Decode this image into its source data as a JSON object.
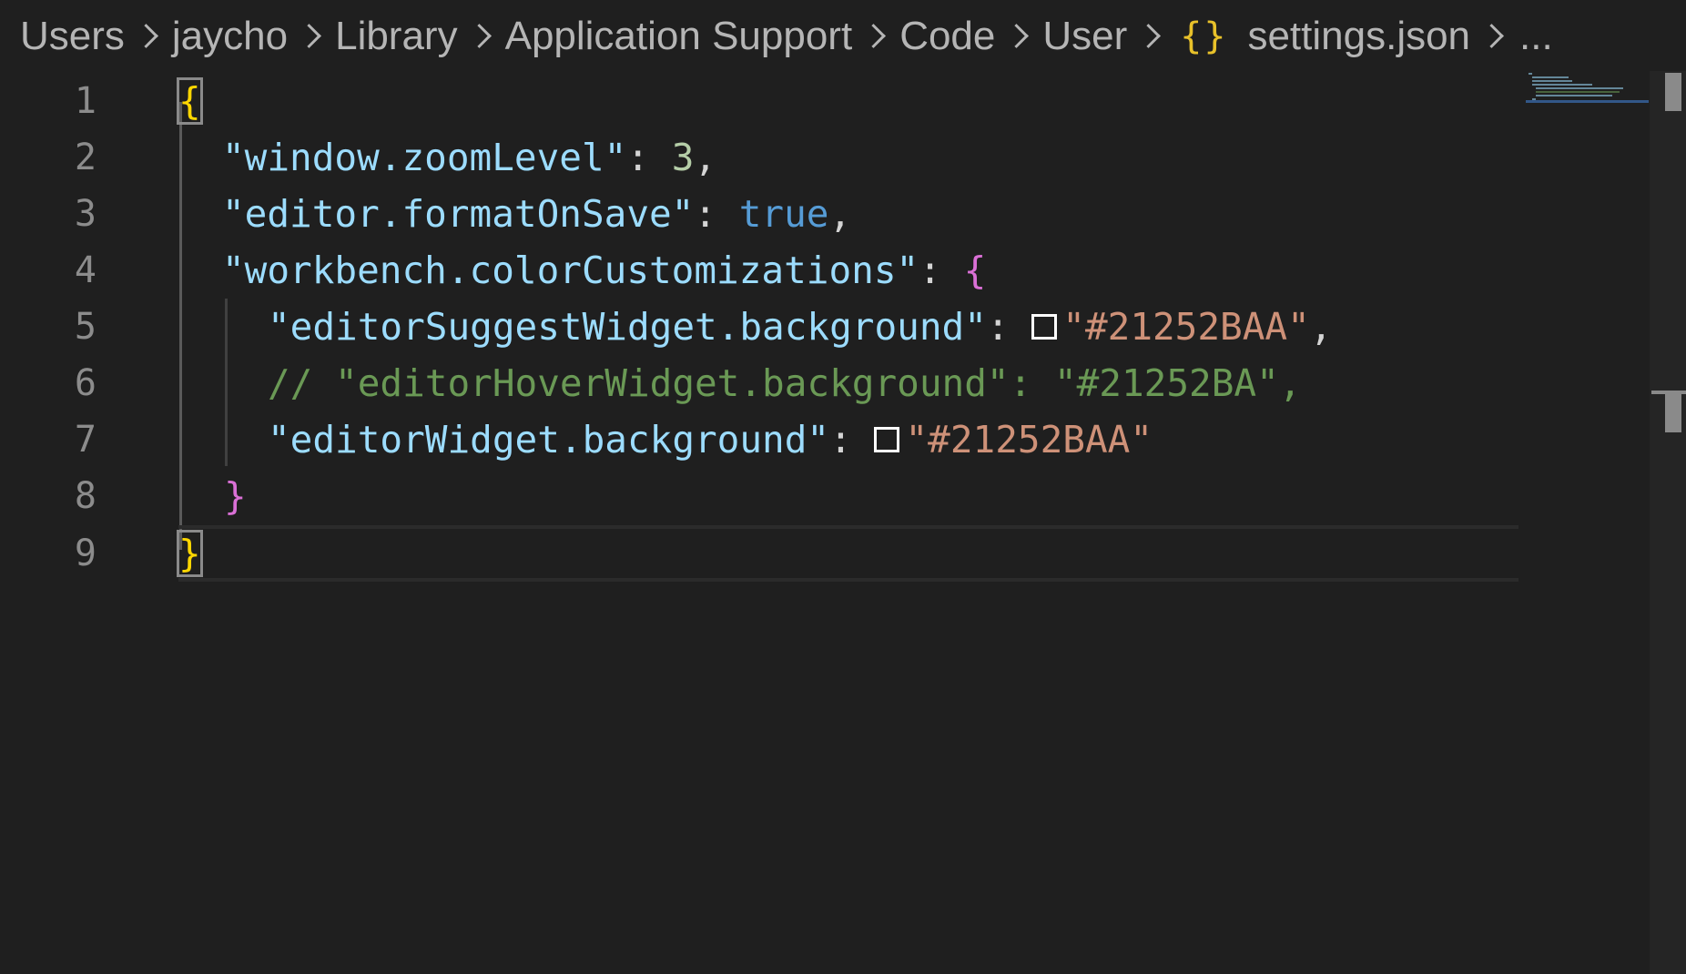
{
  "breadcrumb": {
    "items": [
      "Users",
      "jaycho",
      "Library",
      "Application Support",
      "Code",
      "User"
    ],
    "file_icon": "{}",
    "file_name": "settings.json",
    "ellipsis": "..."
  },
  "editor": {
    "line_numbers": [
      "1",
      "2",
      "3",
      "4",
      "5",
      "6",
      "7",
      "8",
      "9"
    ],
    "lines": {
      "l1": {
        "open": "{"
      },
      "l2": {
        "key": "\"window.zoomLevel\"",
        "colon": ": ",
        "value": "3",
        "comma": ","
      },
      "l3": {
        "key": "\"editor.formatOnSave\"",
        "colon": ": ",
        "value": "true",
        "comma": ","
      },
      "l4": {
        "key": "\"workbench.colorCustomizations\"",
        "colon": ": ",
        "value": "{"
      },
      "l5": {
        "key": "\"editorSuggestWidget.background\"",
        "colon": ": ",
        "value": "\"#21252BAA\"",
        "comma": ","
      },
      "l6": {
        "comment": "// \"editorHoverWidget.background\": \"#21252BA\","
      },
      "l7": {
        "key": "\"editorWidget.background\"",
        "colon": ": ",
        "value": "\"#21252BAA\""
      },
      "l8": {
        "close": "}"
      },
      "l9": {
        "close": "}"
      }
    }
  },
  "colors": {
    "background": "#1f1f1f",
    "key": "#9cdcfe",
    "string": "#ce9178",
    "number": "#b5cea8",
    "boolean": "#569cd6",
    "comment": "#6a9955",
    "bracket_level1": "#ffd700",
    "bracket_level2": "#da70d6"
  }
}
